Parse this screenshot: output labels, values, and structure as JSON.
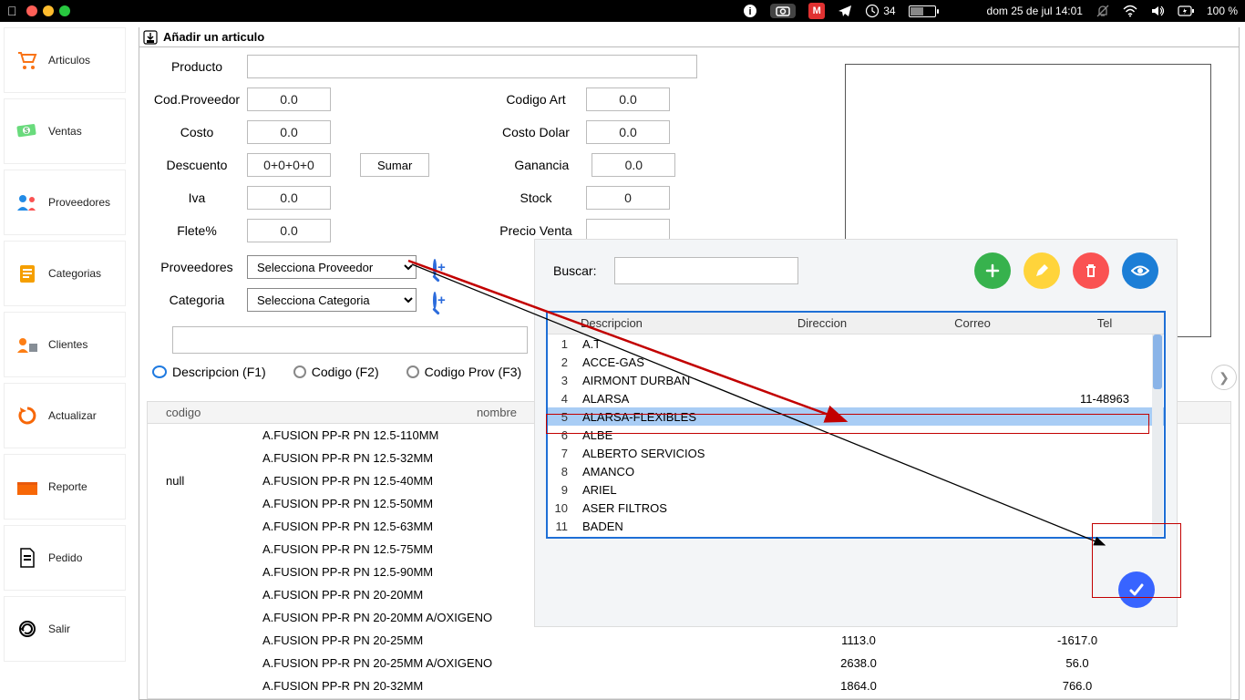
{
  "menubar": {
    "notifications": "34",
    "datetime": "dom 25 de jul  14:01",
    "battery_pct": "100 %"
  },
  "sidebar": {
    "items": [
      {
        "label": "Articulos",
        "icon": "cart-icon"
      },
      {
        "label": "Ventas",
        "icon": "cash-icon"
      },
      {
        "label": "Proveedores",
        "icon": "people-icon"
      },
      {
        "label": "Categorias",
        "icon": "clipboard-icon"
      },
      {
        "label": "Clientes",
        "icon": "client-icon"
      },
      {
        "label": "Actualizar",
        "icon": "refresh-icon"
      },
      {
        "label": "Reporte",
        "icon": "folder-icon"
      },
      {
        "label": "Pedido",
        "icon": "page-icon"
      },
      {
        "label": "Salir",
        "icon": "exit-icon"
      }
    ]
  },
  "window": {
    "title": "Añadir un articulo"
  },
  "form": {
    "producto_label": "Producto",
    "producto_value": "",
    "codprov_label": "Cod.Proveedor",
    "codprov_value": "0.0",
    "codart_label": "Codigo Art",
    "codart_value": "0.0",
    "costo_label": "Costo",
    "costo_value": "0.0",
    "costodolar_label": "Costo Dolar",
    "costodolar_value": "0.0",
    "descuento_label": "Descuento",
    "descuento_value": "0+0+0+0",
    "sumar_label": "Sumar",
    "ganancia_label": "Ganancia",
    "ganancia_value": "0.0",
    "iva_label": "Iva",
    "iva_value": "0.0",
    "stock_label": "Stock",
    "stock_value": "0",
    "flete_label": "Flete%",
    "flete_value": "0.0",
    "precioventa_label": "Precio Venta",
    "precioventa_value": "",
    "proveedores_label": "Proveedores",
    "proveedores_value": "Selecciona Proveedor",
    "categoria_label": "Categoria",
    "categoria_value": "Selecciona Categoria"
  },
  "filter": {
    "search_value": "",
    "opt_descripcion": "Descripcion (F1)",
    "opt_codigo": "Codigo (F2)",
    "opt_codigoprov": "Codigo Prov (F3)"
  },
  "table": {
    "headers": {
      "codigo": "codigo",
      "nombre": "nombre"
    },
    "rows": [
      {
        "codigo": "",
        "nombre": "A.FUSION PP-R PN 12.5-110MM",
        "v1": "",
        "v2": ""
      },
      {
        "codigo": "",
        "nombre": "A.FUSION PP-R PN 12.5-32MM",
        "v1": "",
        "v2": ""
      },
      {
        "codigo": "null",
        "nombre": "A.FUSION PP-R PN 12.5-40MM",
        "v1": "",
        "v2": ""
      },
      {
        "codigo": "",
        "nombre": "A.FUSION PP-R PN 12.5-50MM",
        "v1": "",
        "v2": ""
      },
      {
        "codigo": "",
        "nombre": "A.FUSION PP-R PN 12.5-63MM",
        "v1": "",
        "v2": ""
      },
      {
        "codigo": "",
        "nombre": "A.FUSION PP-R PN 12.5-75MM",
        "v1": "",
        "v2": ""
      },
      {
        "codigo": "",
        "nombre": "A.FUSION PP-R PN 12.5-90MM",
        "v1": "",
        "v2": ""
      },
      {
        "codigo": "",
        "nombre": "A.FUSION PP-R PN 20-20MM",
        "v1": "",
        "v2": ""
      },
      {
        "codigo": "",
        "nombre": "A.FUSION PP-R PN 20-20MM A/OXIGENO",
        "v1": "",
        "v2": ""
      },
      {
        "codigo": "",
        "nombre": "A.FUSION PP-R PN 20-25MM",
        "v1": "1113.0",
        "v2": "-1617.0"
      },
      {
        "codigo": "",
        "nombre": "A.FUSION PP-R PN 20-25MM A/OXIGENO",
        "v1": "2638.0",
        "v2": "56.0"
      },
      {
        "codigo": "",
        "nombre": "A.FUSION PP-R PN 20-32MM",
        "v1": "1864.0",
        "v2": "766.0"
      }
    ]
  },
  "popup": {
    "search_label": "Buscar:",
    "search_value": "",
    "headers": {
      "descripcion": "Descripcion",
      "direccion": "Direccion",
      "correo": "Correo",
      "tel": "Tel"
    },
    "rows": [
      {
        "n": "1",
        "desc": "A.T",
        "tel": ""
      },
      {
        "n": "2",
        "desc": "ACCE-GAS",
        "tel": ""
      },
      {
        "n": "3",
        "desc": "AIRMONT DURBAN",
        "tel": ""
      },
      {
        "n": "4",
        "desc": "ALARSA",
        "tel": "11-48963"
      },
      {
        "n": "5",
        "desc": "ALARSA-FLEXIBLES",
        "tel": ""
      },
      {
        "n": "6",
        "desc": "ALBE",
        "tel": ""
      },
      {
        "n": "7",
        "desc": "ALBERTO SERVICIOS",
        "tel": ""
      },
      {
        "n": "8",
        "desc": "AMANCO",
        "tel": ""
      },
      {
        "n": "9",
        "desc": "ARIEL",
        "tel": ""
      },
      {
        "n": "10",
        "desc": "ASER FILTROS",
        "tel": ""
      },
      {
        "n": "11",
        "desc": "BADEN",
        "tel": ""
      }
    ],
    "selected_index": 4
  }
}
